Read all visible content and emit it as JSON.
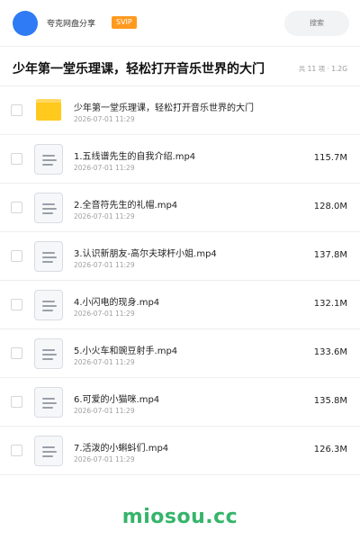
{
  "header": {
    "brand": "夸克网盘分享",
    "badge": "SVIP",
    "search_placeholder": "搜索"
  },
  "title_bar": {
    "title": "少年第一堂乐理课，轻松打开音乐世界的大门",
    "meta": "共 11 项 · 1.2G"
  },
  "files": [
    {
      "type": "folder",
      "name": "少年第一堂乐理课，轻松打开音乐世界的大门",
      "date": "2026-07-01 11:29",
      "size": ""
    },
    {
      "type": "file",
      "name": "1.五线谱先生的自我介绍.mp4",
      "date": "2026-07-01 11:29",
      "size": "115.7M"
    },
    {
      "type": "file",
      "name": "2.全音符先生的礼帽.mp4",
      "date": "2026-07-01 11:29",
      "size": "128.0M"
    },
    {
      "type": "file",
      "name": "3.认识新朋友-高尔夫球杆小姐.mp4",
      "date": "2026-07-01 11:29",
      "size": "137.8M"
    },
    {
      "type": "file",
      "name": "4.小闪电的现身.mp4",
      "date": "2026-07-01 11:29",
      "size": "132.1M"
    },
    {
      "type": "file",
      "name": "5.小火车和豌豆射手.mp4",
      "date": "2026-07-01 11:29",
      "size": "133.6M"
    },
    {
      "type": "file",
      "name": "6.可爱的小猫咪.mp4",
      "date": "2026-07-01 11:29",
      "size": "135.8M"
    },
    {
      "type": "file",
      "name": "7.活泼的小蝌蚪们.mp4",
      "date": "2026-07-01 11:29",
      "size": "126.3M"
    }
  ],
  "watermark": "miosou.cc",
  "colors": {
    "avatar": "#2f7bf5",
    "svip_badge": "#ff9a1f",
    "folder": "#ffc91e",
    "watermark": "#35b46a"
  },
  "icons": {
    "folder": "folder-icon",
    "file": "video-file-icon"
  }
}
